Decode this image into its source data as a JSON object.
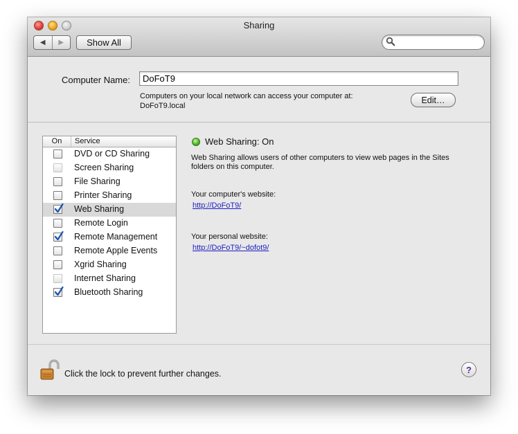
{
  "window": {
    "title": "Sharing"
  },
  "toolbar": {
    "back_label": "◀",
    "forward_label": "▶",
    "show_all_label": "Show All",
    "search_value": ""
  },
  "computer": {
    "name_label": "Computer Name:",
    "name_value": "DoFoT9",
    "desc_line1": "Computers on your local network can access your computer at:",
    "desc_line2": "DoFoT9.local",
    "edit_label": "Edit…"
  },
  "services": {
    "header_on": "On",
    "header_service": "Service",
    "items": [
      {
        "label": "DVD or CD Sharing",
        "checked": false,
        "disabled": false,
        "selected": false
      },
      {
        "label": "Screen Sharing",
        "checked": false,
        "disabled": true,
        "selected": false
      },
      {
        "label": "File Sharing",
        "checked": false,
        "disabled": false,
        "selected": false
      },
      {
        "label": "Printer Sharing",
        "checked": false,
        "disabled": false,
        "selected": false
      },
      {
        "label": "Web Sharing",
        "checked": true,
        "disabled": false,
        "selected": true
      },
      {
        "label": "Remote Login",
        "checked": false,
        "disabled": false,
        "selected": false
      },
      {
        "label": "Remote Management",
        "checked": true,
        "disabled": false,
        "selected": false
      },
      {
        "label": "Remote Apple Events",
        "checked": false,
        "disabled": false,
        "selected": false
      },
      {
        "label": "Xgrid Sharing",
        "checked": false,
        "disabled": false,
        "selected": false
      },
      {
        "label": "Internet Sharing",
        "checked": false,
        "disabled": true,
        "selected": false
      },
      {
        "label": "Bluetooth Sharing",
        "checked": true,
        "disabled": false,
        "selected": false
      }
    ]
  },
  "detail": {
    "status_title": "Web Sharing: On",
    "description_line1": "Web Sharing allows users of other computers to view web pages in the Sites",
    "description_line2": "folders on this computer.",
    "computer_site_label": "Your computer's website:",
    "computer_site_url": "http://DoFoT9/",
    "personal_site_label": "Your personal website:",
    "personal_site_url": "http://DoFoT9/~dofot9/"
  },
  "footer": {
    "lock_text": "Click the lock to prevent further changes.",
    "help_label": "?"
  },
  "colors": {
    "status_on": "#46b41b",
    "link": "#1c1cc0",
    "check": "#1a4fb5"
  }
}
